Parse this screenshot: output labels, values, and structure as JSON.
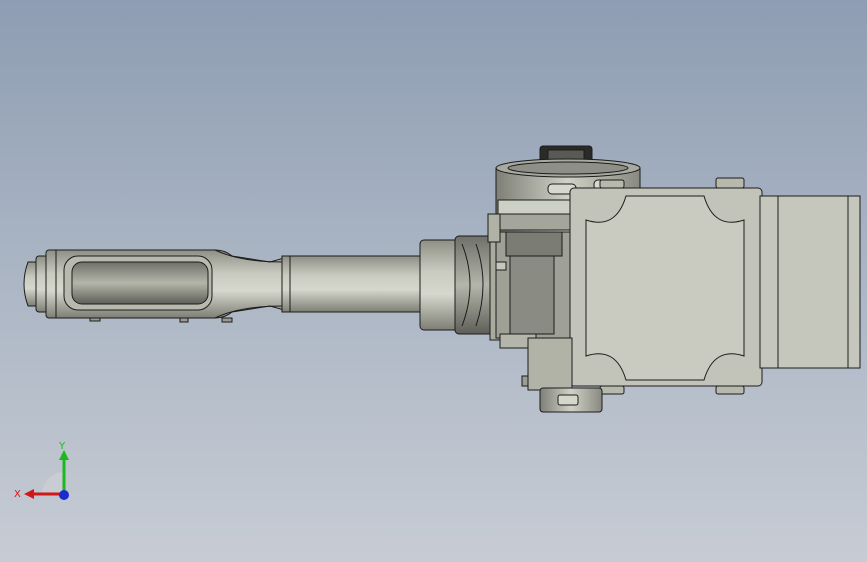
{
  "view": {
    "background_top": "#8e9db3",
    "background_bottom": "#c7ccd4",
    "part_color": "#b9bbb0",
    "edge_color": "#1c1c1c"
  },
  "triad": {
    "x_label": "X",
    "y_label": "Y",
    "x_color": "#d01818",
    "y_color": "#1db81d",
    "z_color": "#1a2ccf"
  }
}
